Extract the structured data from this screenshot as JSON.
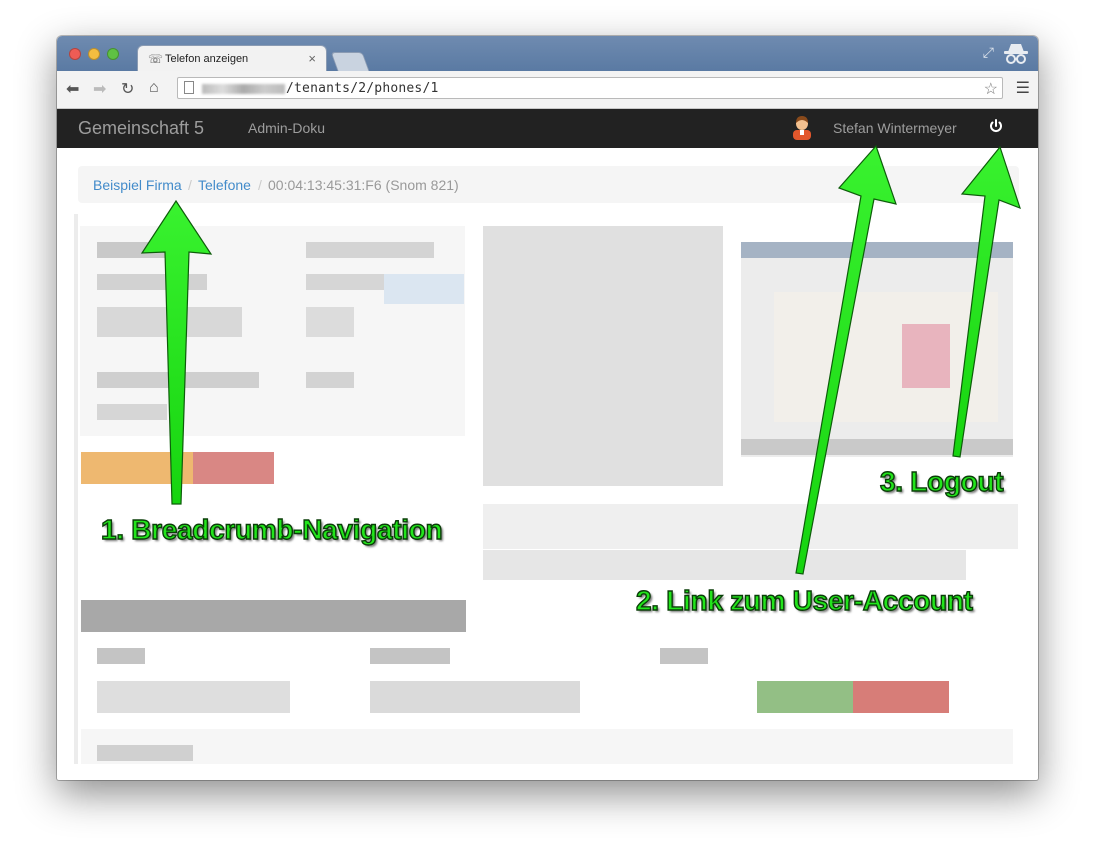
{
  "browser": {
    "tab_title": "Telefon anzeigen",
    "tab_close": "×",
    "url_path": "/tenants/2/phones/1"
  },
  "navbar": {
    "brand": "Gemeinschaft 5",
    "admin_doku": "Admin-Doku",
    "user_name": "Stefan Wintermeyer"
  },
  "breadcrumb": {
    "items": [
      "Beispiel Firma",
      "Telefone"
    ],
    "separator": "/",
    "active": "00:04:13:45:31:F6 (Snom 821)"
  },
  "annotations": {
    "breadcrumb": "1. Breadcrumb-Navigation",
    "user_account": "2. Link zum User-Account",
    "logout": "3. Logout"
  },
  "colors": {
    "annotation_green": "#22e51b",
    "navbar_bg": "#222222",
    "link_blue": "#428bca"
  }
}
